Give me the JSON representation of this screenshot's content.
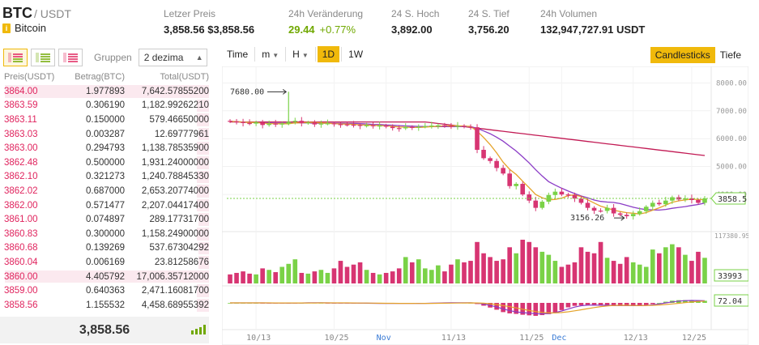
{
  "header": {
    "base": "BTC",
    "quote": "/ USDT",
    "coin_name": "Bitcoin",
    "info_glyph": "i",
    "stats": [
      {
        "label": "Letzer Preis",
        "value": "3,858.56 $3,858.56"
      },
      {
        "label": "24h Veränderung",
        "value": "29.44",
        "extra": "+0.77%"
      },
      {
        "label": "24 S. Hoch",
        "value": "3,892.00"
      },
      {
        "label": "24 S. Tief",
        "value": "3,756.20"
      },
      {
        "label": "24h Volumen",
        "value": "132,947,727.91 USDT"
      }
    ]
  },
  "book": {
    "groups_label": "Gruppen",
    "groups_value": "2 dezima",
    "columns": [
      "Preis(USDT)",
      "Betrag(BTC)",
      "Total(USDT)"
    ],
    "rows": [
      {
        "p1": "3864.",
        "p2": "00",
        "amount": "1.977893",
        "total": "7,642.57855200",
        "depth": 1.0
      },
      {
        "p1": "3863.",
        "p2": "59",
        "amount": "0.306190",
        "total": "1,182.99262210",
        "depth": 0.06
      },
      {
        "p1": "3863.",
        "p2": "11",
        "amount": "0.150000",
        "total": "579.46650000",
        "depth": 0.06
      },
      {
        "p1": "3863.",
        "p2": "03",
        "amount": "0.003287",
        "total": "12.69777961",
        "depth": 0.05
      },
      {
        "p1": "3863.",
        "p2": "00",
        "amount": "0.294793",
        "total": "1,138.78535900",
        "depth": 0.06
      },
      {
        "p1": "3862.",
        "p2": "48",
        "amount": "0.500000",
        "total": "1,931.24000000",
        "depth": 0.06
      },
      {
        "p1": "3862.",
        "p2": "10",
        "amount": "0.321273",
        "total": "1,240.78845330",
        "depth": 0.06
      },
      {
        "p1": "3862.",
        "p2": "02",
        "amount": "0.687000",
        "total": "2,653.20774000",
        "depth": 0.06
      },
      {
        "p1": "3862.",
        "p2": "00",
        "amount": "0.571477",
        "total": "2,207.04417400",
        "depth": 0.06
      },
      {
        "p1": "3861.",
        "p2": "00",
        "amount": "0.074897",
        "total": "289.17731700",
        "depth": 0.05
      },
      {
        "p1": "3860.",
        "p2": "83",
        "amount": "0.300000",
        "total": "1,158.24900000",
        "depth": 0.06
      },
      {
        "p1": "3860.",
        "p2": "68",
        "amount": "0.139269",
        "total": "537.67304292",
        "depth": 0.05
      },
      {
        "p1": "3860.",
        "p2": "04",
        "amount": "0.006169",
        "total": "23.81258676",
        "depth": 0.05
      },
      {
        "p1": "3860.",
        "p2": "00",
        "amount": "4.405792",
        "total": "17,006.35712000",
        "depth": 1.0
      },
      {
        "p1": "3859.",
        "p2": "00",
        "amount": "0.640363",
        "total": "2,471.16081700",
        "depth": 0.06
      },
      {
        "p1": "3858.",
        "p2": "56",
        "amount": "1.155532",
        "total": "4,458.68955392",
        "depth": 0.06
      }
    ],
    "last_price": "3,858.56"
  },
  "chart_toolbar": {
    "time": "Time",
    "minute": "m",
    "hour": "H",
    "day": "1D",
    "week": "1W",
    "candles": "Candlesticks",
    "depth": "Tiefe"
  },
  "chart_data": {
    "type": "candlestick",
    "price_ticks": [
      "8000.00",
      "7000.00",
      "6000.00",
      "5000.00",
      "4000.00"
    ],
    "price_ticks_values": [
      8000,
      7000,
      6000,
      5000,
      4000
    ],
    "price_range": [
      2900,
      8300
    ],
    "x_labels": [
      "10/13",
      "10/25",
      "Nov",
      "11/13",
      "11/25",
      "Dec",
      "12/13",
      "12/25"
    ],
    "annotations": {
      "high": "7680.00",
      "low": "3156.26",
      "last": "3858.5"
    },
    "volume_label_max": "117380.95",
    "volume_last_label": "33993",
    "indicator_last_label": "72.04",
    "closes": [
      6620,
      6600,
      6560,
      6540,
      6590,
      6490,
      6540,
      6510,
      6540,
      6600,
      6640,
      6560,
      6580,
      6510,
      6540,
      6550,
      6520,
      6510,
      6500,
      6490,
      6460,
      6480,
      6450,
      6470,
      6430,
      6380,
      6370,
      6420,
      6400,
      6430,
      6450,
      6470,
      6480,
      6450,
      6440,
      6460,
      6430,
      6410,
      5600,
      5300,
      5200,
      4950,
      4750,
      4300,
      4380,
      4000,
      3780,
      3520,
      3740,
      3980,
      4100,
      4000,
      3980,
      3850,
      3700,
      3520,
      3420,
      3410,
      3520,
      3320,
      3270,
      3220,
      3300,
      3400,
      3560,
      3700,
      3650,
      3780,
      3900,
      3820,
      3860,
      3800,
      3700,
      3858
    ],
    "volumes": [
      12,
      14,
      16,
      13,
      12,
      20,
      18,
      15,
      22,
      26,
      32,
      14,
      13,
      16,
      18,
      14,
      20,
      30,
      22,
      25,
      28,
      18,
      14,
      12,
      14,
      16,
      20,
      35,
      28,
      32,
      20,
      18,
      24,
      16,
      25,
      32,
      28,
      30,
      55,
      40,
      35,
      30,
      32,
      48,
      40,
      58,
      55,
      48,
      42,
      38,
      30,
      22,
      25,
      28,
      48,
      42,
      40,
      55,
      34,
      30,
      26,
      35,
      28,
      25,
      22,
      45,
      40,
      48,
      52,
      48,
      38,
      30,
      42,
      34
    ]
  },
  "colors": {
    "up": "#7ad247",
    "down": "#d73572",
    "ma1": "#e5a32a",
    "ma2": "#8b3cc6",
    "ma3": "#c21a54",
    "accent": "#f0b90b"
  }
}
